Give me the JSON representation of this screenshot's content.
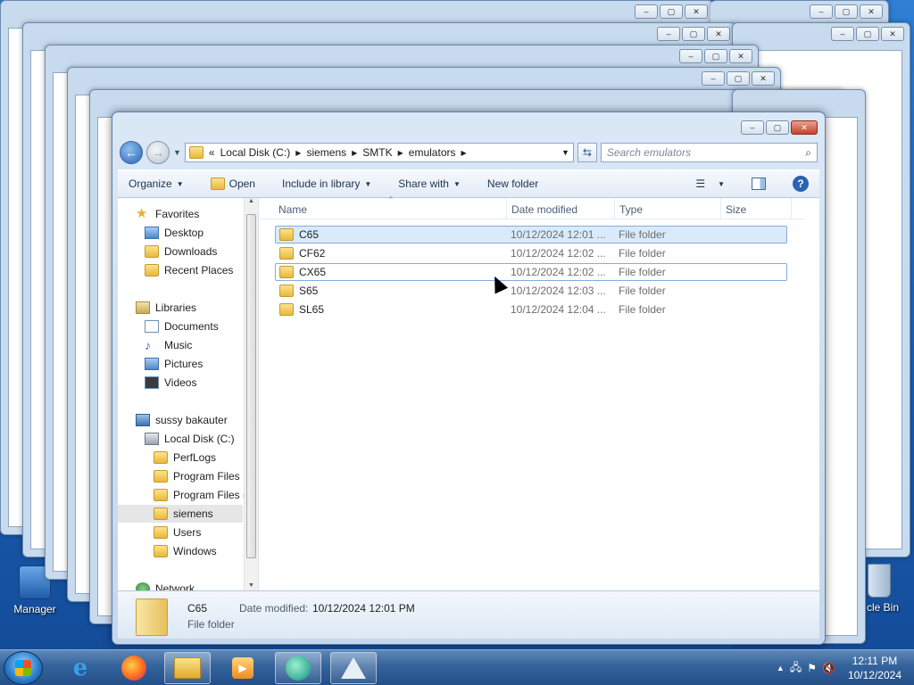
{
  "desktop": {
    "icons": [
      {
        "label": "Manager",
        "icon": "manager-icon"
      },
      {
        "label": "cle Bin",
        "icon": "recycle-bin-icon"
      }
    ]
  },
  "window": {
    "address": {
      "chevron": "«",
      "segments": [
        "Local Disk (C:)",
        "siemens",
        "SMTK",
        "emulators"
      ]
    },
    "search_placeholder": "Search emulators",
    "toolbar": {
      "organize": "Organize",
      "open": "Open",
      "include": "Include in library",
      "share": "Share with",
      "new_folder": "New folder"
    },
    "nav": {
      "favorites": "Favorites",
      "desktop": "Desktop",
      "downloads": "Downloads",
      "recent": "Recent Places",
      "libraries": "Libraries",
      "documents": "Documents",
      "music": "Music",
      "pictures": "Pictures",
      "videos": "Videos",
      "computer": "sussy bakauter",
      "local_disk": "Local Disk (C:)",
      "perflogs": "PerfLogs",
      "program_files": "Program Files",
      "program_files_x86": "Program Files (",
      "siemens": "siemens",
      "users": "Users",
      "windows": "Windows",
      "network": "Network"
    },
    "columns": {
      "name": "Name",
      "date": "Date modified",
      "type": "Type",
      "size": "Size"
    },
    "files": [
      {
        "name": "C65",
        "date": "10/12/2024 12:01 ...",
        "type": "File folder"
      },
      {
        "name": "CF62",
        "date": "10/12/2024 12:02 ...",
        "type": "File folder"
      },
      {
        "name": "CX65",
        "date": "10/12/2024 12:02 ...",
        "type": "File folder"
      },
      {
        "name": "S65",
        "date": "10/12/2024 12:03 ...",
        "type": "File folder"
      },
      {
        "name": "SL65",
        "date": "10/12/2024 12:04 ...",
        "type": "File folder"
      }
    ],
    "details": {
      "name": "C65",
      "date_label": "Date modified:",
      "date_value": "10/12/2024 12:01 PM",
      "type": "File folder"
    }
  },
  "taskbar": {
    "time": "12:11 PM",
    "date": "10/12/2024"
  }
}
